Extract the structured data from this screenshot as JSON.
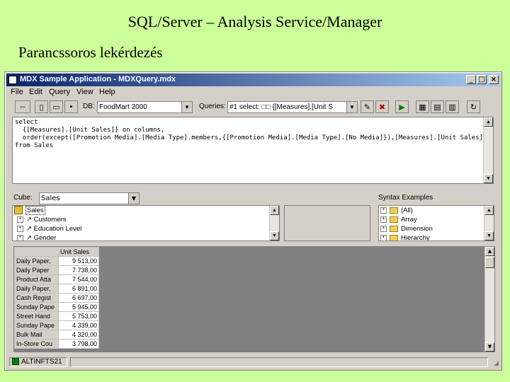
{
  "slide": {
    "title": "SQL/Server – Analysis Service/Manager",
    "subtitle": "Parancssoros lekérdezés"
  },
  "window": {
    "title": "MDX Sample Application - MDXQuery.mdx",
    "controls": {
      "minimize": "_",
      "maximize": "□",
      "close": "×"
    }
  },
  "menu": [
    "File",
    "Edit",
    "Query",
    "View",
    "Help"
  ],
  "toolbar": {
    "db_label": "DB:",
    "db_value": "FoodMart 2000",
    "queries_label": "Queries:",
    "queries_value": "#1 select: □□     {[Measures].[Unit S"
  },
  "query_lines": [
    "select",
    "  {[Measures].[Unit Sales]} on columns,",
    "  order(except([Promotion Media].[Media Type].members,{[Promotion Media].[Media Type].[No Media]}),[Measures].[Unit Sales],DESC) on rows",
    "from Sales"
  ],
  "cube": {
    "label": "Cube:",
    "value": "Sales",
    "tree": [
      "Sales",
      "Customers",
      "Education Level",
      "Gender"
    ]
  },
  "syntax": {
    "label": "Syntax Examples",
    "items": [
      "(All)",
      "Array",
      "Dimension",
      "Hierarchy"
    ]
  },
  "results": {
    "column_header": "Unit Sales",
    "rows": [
      {
        "label": "Daily Paper,",
        "value": "9 513,00"
      },
      {
        "label": "Daily Paper",
        "value": "7 738,00"
      },
      {
        "label": "Product Atta",
        "value": "7 544,00"
      },
      {
        "label": "Daily Paper,",
        "value": "6 891,00"
      },
      {
        "label": "Cash Regist",
        "value": "6 697,00"
      },
      {
        "label": "Sunday Pape",
        "value": "5 945,00"
      },
      {
        "label": "Street Hand",
        "value": "5 753,00"
      },
      {
        "label": "Sunday Pape",
        "value": "4 339,00"
      },
      {
        "label": "Bulk Mail",
        "value": "4 320,00"
      },
      {
        "label": "In-Store Cou",
        "value": "3 798,00"
      }
    ]
  },
  "status": {
    "text": "ALTINFTS21"
  }
}
